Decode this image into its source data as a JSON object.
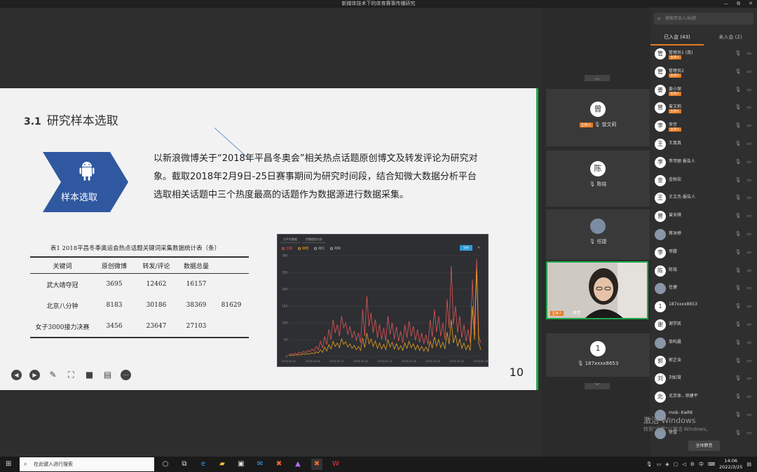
{
  "window": {
    "title": "新媒体技术下的体育赛事传播研究",
    "controls": [
      "—",
      "⧉",
      "✕"
    ]
  },
  "slide": {
    "section_num": "3.1",
    "section_title": "研究样本选取",
    "badge_label": "样本选取",
    "body": "以新浪微博关于“2018年平昌冬奥会”相关热点话题原创博文及转发评论为研究对象。截取2018年2月9日-25日赛事期间为研究时间段，结合知微大数据分析平台选取相关话题中三个热度最高的话题作为数据源进行数据采集。",
    "table": {
      "caption": "表1 2018平昌冬季奥运会热点话题关键词采集数据统计表（条）",
      "headers": [
        "关键词",
        "原创微博",
        "转发/评论",
        "数据总量",
        ""
      ],
      "rows": [
        [
          "武大靖夺冠",
          "3695",
          "12462",
          "16157",
          ""
        ],
        [
          "北京八分钟",
          "8183",
          "30186",
          "38369",
          "81629"
        ],
        [
          "女子3000接力决赛",
          "3456",
          "23647",
          "27103",
          ""
        ]
      ]
    },
    "page_number": "10"
  },
  "chart_data": {
    "type": "line",
    "tabs": [
      "分平台数据",
      "传播趋势分析"
    ],
    "legend": [
      "全部",
      "微博",
      "微信",
      "网媒"
    ],
    "button": "分析",
    "y_ticks": [
      "300",
      "250",
      "200",
      "150",
      "100",
      "50",
      "0"
    ],
    "x_ticks": [
      "2018-02-01",
      "2018-02-04",
      "2018-02-07",
      "2018-02-10",
      "2018-02-13",
      "2018-02-16",
      "2018-02-19",
      "2018-02-22",
      "2018-02-25"
    ],
    "ylim": [
      0,
      300
    ],
    "series": [
      {
        "values": [
          5,
          8,
          6,
          10,
          7,
          12,
          9,
          15,
          11,
          18,
          14,
          22,
          16,
          30,
          20,
          45,
          25,
          60,
          35,
          80,
          50,
          110,
          70,
          95,
          60,
          120,
          85,
          100,
          65,
          90,
          55,
          75,
          48,
          70,
          40,
          140,
          60,
          180,
          90,
          130,
          70,
          110,
          55,
          95,
          50,
          85,
          45,
          120,
          65,
          100,
          52,
          88,
          46,
          75,
          40,
          95,
          55,
          105,
          60,
          90,
          48,
          80,
          42,
          70,
          38,
          65,
          35,
          110,
          58,
          140,
          72,
          120,
          60,
          100,
          50,
          170,
          85,
          270,
          95,
          150,
          70,
          120,
          55,
          95,
          45,
          80,
          40,
          230,
          80,
          290,
          60,
          40
        ],
        "color": "#e05555"
      },
      {
        "values": [
          2,
          4,
          3,
          5,
          4,
          6,
          5,
          8,
          6,
          9,
          7,
          11,
          8,
          14,
          10,
          20,
          12,
          28,
          16,
          35,
          22,
          45,
          30,
          40,
          26,
          52,
          36,
          44,
          28,
          38,
          24,
          33,
          20,
          30,
          18,
          55,
          26,
          70,
          38,
          52,
          30,
          46,
          24,
          40,
          22,
          36,
          20,
          50,
          28,
          42,
          22,
          38,
          20,
          32,
          18,
          40,
          24,
          45,
          26,
          38,
          20,
          34,
          18,
          30,
          16,
          28,
          15,
          46,
          25,
          58,
          30,
          50,
          26,
          42,
          22,
          72,
          36,
          110,
          40,
          64,
          30,
          52,
          24,
          40,
          20,
          34,
          18,
          150,
          50,
          260,
          40,
          20
        ],
        "color": "#e8a020"
      }
    ]
  },
  "toolbar": {
    "icons": [
      "prev-icon",
      "next-icon",
      "pen-icon",
      "screenshot-icon",
      "camera-icon",
      "chat-icon",
      "more-icon"
    ]
  },
  "video": {
    "tiles": [
      {
        "avatar": "曾",
        "name": "曾文莉",
        "host_tag": "主持人"
      },
      {
        "avatar": "陈",
        "name": "陈铭",
        "host_tag": ""
      },
      {
        "avatar": "",
        "name": "任捷",
        "host_tag": ""
      },
      {
        "avatar": "",
        "name": "李芳",
        "host_tag": "主持人"
      },
      {
        "avatar": "1",
        "name": "187xxxx8653",
        "host_tag": ""
      }
    ],
    "arrow_up": "︿",
    "arrow_down": "﹀"
  },
  "sidebar": {
    "search_placeholder": "搜索参会人/标题",
    "tab_joined": "已入会 (43)",
    "tab_not_joined": "未入会 (2)",
    "participants": [
      {
        "avatar": "管",
        "name": "管理员1 (我)",
        "tag": "主持人"
      },
      {
        "avatar": "管",
        "name": "管理员2",
        "tag": "主持人"
      },
      {
        "avatar": "姜",
        "name": "姜小琛",
        "tag": "主持人"
      },
      {
        "avatar": "曾",
        "name": "曾文莉",
        "tag": "主持人"
      },
      {
        "avatar": "李",
        "name": "李芳",
        "tag": "主持人"
      },
      {
        "avatar": "王",
        "name": "王真真",
        "tag": ""
      },
      {
        "avatar": "李",
        "name": "李沛丽 报告人",
        "tag": ""
      },
      {
        "avatar": "金",
        "name": "金秋宏",
        "tag": ""
      },
      {
        "avatar": "王",
        "name": "王文杰-报告人",
        "tag": ""
      },
      {
        "avatar": "曾",
        "name": "曾天棋",
        "tag": ""
      },
      {
        "avatar": "",
        "name": "蒋冰婷",
        "tag": ""
      },
      {
        "avatar": "李",
        "name": "李滕",
        "tag": ""
      },
      {
        "avatar": "陈",
        "name": "陈铭",
        "tag": ""
      },
      {
        "avatar": "",
        "name": "任捷",
        "tag": ""
      },
      {
        "avatar": "1",
        "name": "187xxxx8653",
        "tag": ""
      },
      {
        "avatar": "谢",
        "name": "谢学凯",
        "tag": ""
      },
      {
        "avatar": "",
        "name": "单昀晨",
        "tag": ""
      },
      {
        "avatar": "郭",
        "name": "郭芷含",
        "tag": ""
      },
      {
        "avatar": "刘",
        "name": "刘虹霄",
        "tag": ""
      },
      {
        "avatar": "北",
        "name": "北京体...徐建平",
        "tag": ""
      },
      {
        "avatar": "",
        "name": "mob- KwRK",
        "tag": ""
      },
      {
        "avatar": "",
        "name": "徐雪",
        "tag": ""
      }
    ],
    "mute_all": "全体静音"
  },
  "watermark": {
    "line1": "激活 Windows",
    "line2": "转到\"设置\"以激活 Windows。"
  },
  "taskbar": {
    "search_placeholder": "在此键入进行搜索",
    "ime": "中",
    "time": "14:06",
    "date": "2022/3/25"
  },
  "colors": {
    "accent": "#e57a23",
    "active_border": "#1fa84a",
    "chevron": "#2f58a0"
  }
}
